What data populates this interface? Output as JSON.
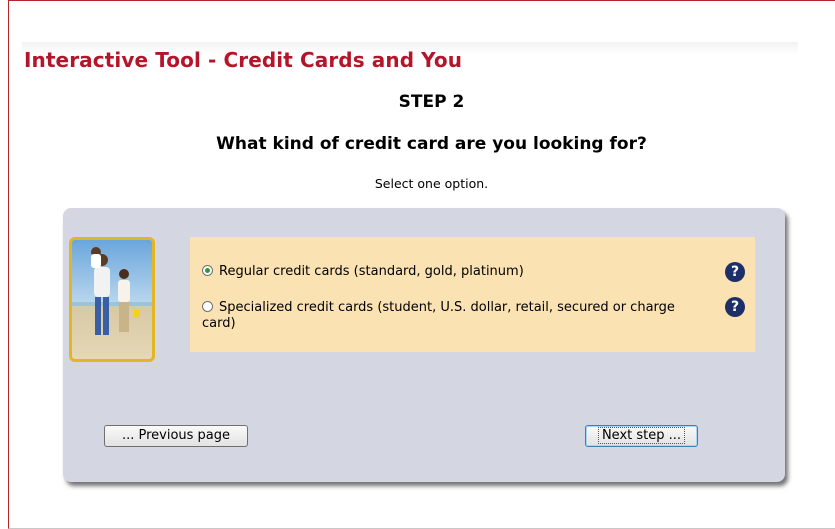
{
  "header": {
    "title": "Interactive Tool - Credit Cards and You"
  },
  "step": {
    "label": "STEP 2",
    "question": "What kind of credit card are you looking for?",
    "instruction": "Select one option."
  },
  "options": [
    {
      "label": "Regular credit cards (standard, gold, platinum)",
      "selected": true
    },
    {
      "label": "Specialized credit cards (student, U.S. dollar, retail, secured or charge card)",
      "selected": false
    }
  ],
  "help_icon": "?",
  "buttons": {
    "previous": "... Previous page",
    "next": "Next step ..."
  },
  "colors": {
    "title": "#b5152b",
    "panel": "#d4d6e2",
    "options_bg": "#fbe2b2",
    "photo_border": "#e2b524",
    "help_icon": "#1c2f68"
  }
}
